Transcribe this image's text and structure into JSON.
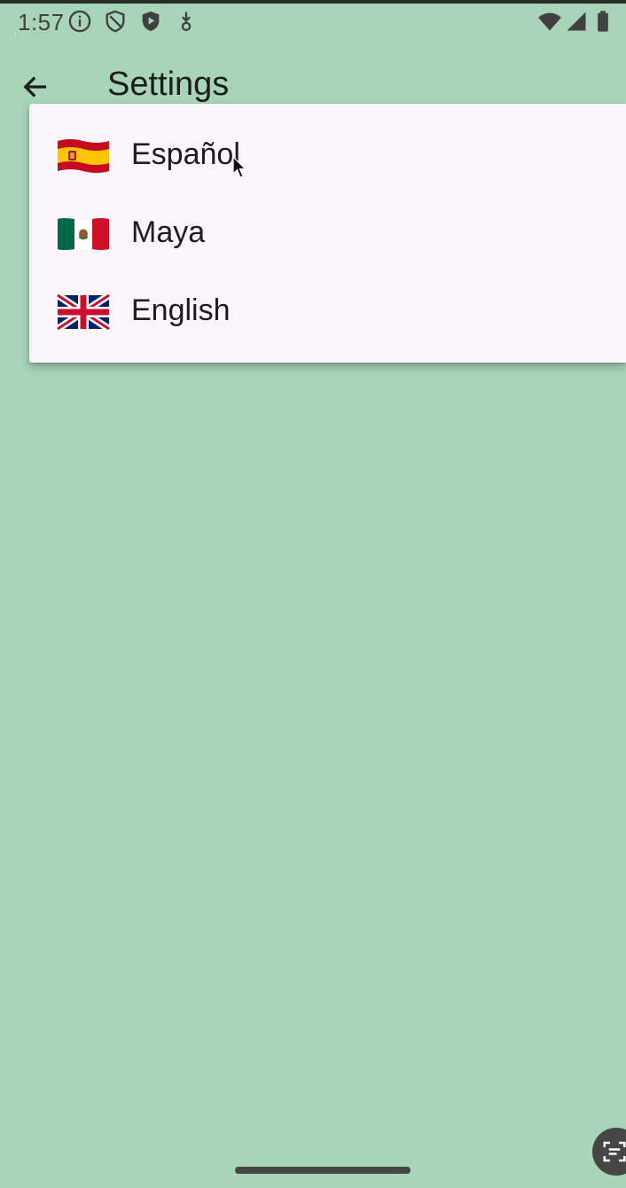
{
  "colors": {
    "background": "#a8d5b8",
    "menu_background": "#fbf4fb",
    "text": "#1c1b1f"
  },
  "status_bar": {
    "time": "1:57",
    "left_icons": [
      "info-icon",
      "shield-icon",
      "play-protect-icon",
      "download-icon"
    ],
    "right_icons": [
      "wifi-icon",
      "signal-icon",
      "battery-icon"
    ]
  },
  "app_bar": {
    "back_icon": "arrow-back-icon",
    "title": "Settings"
  },
  "language_menu": {
    "items": [
      {
        "label": "Español",
        "flag": "spain-flag-icon"
      },
      {
        "label": "Maya",
        "flag": "mexico-flag-icon"
      },
      {
        "label": "English",
        "flag": "uk-flag-icon"
      }
    ]
  },
  "bottom": {
    "action_icon": "screen-search-icon"
  }
}
